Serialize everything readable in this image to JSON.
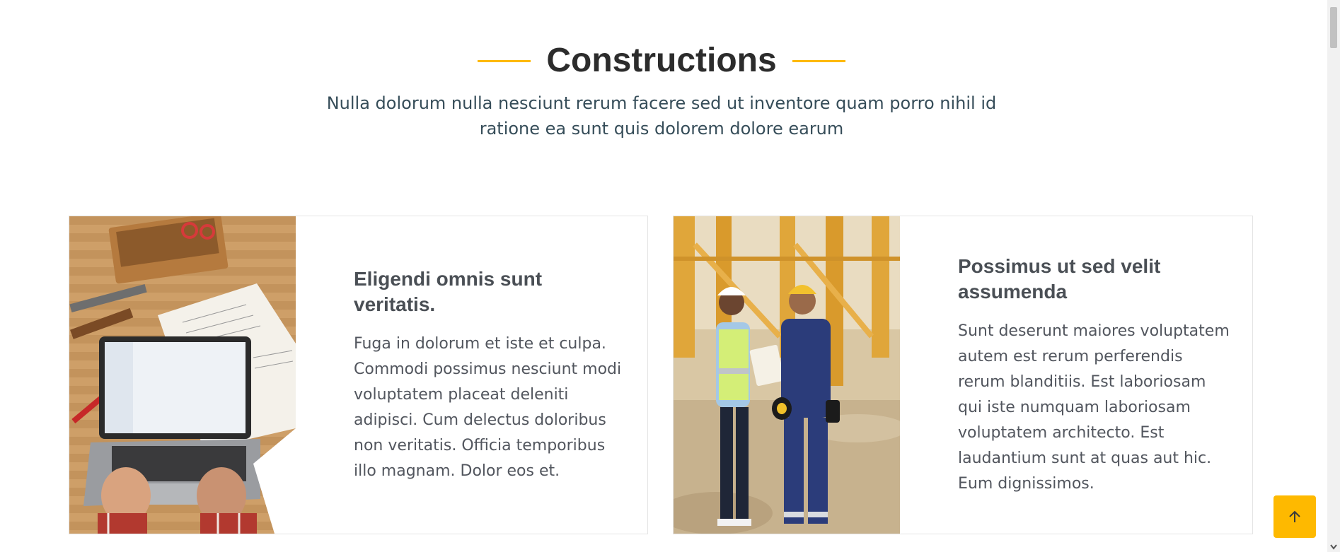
{
  "section": {
    "title": "Constructions",
    "subtitle": "Nulla dolorum nulla nesciunt rerum facere sed ut inventore quam porro nihil id ratione ea sunt quis dolorem dolore earum"
  },
  "cards": [
    {
      "title": "Eligendi omnis sunt veritatis.",
      "text": "Fuga in dolorum et iste et culpa. Commodi possimus nesciunt modi voluptatem placeat deleniti adipisci. Cum delectus doloribus non veritatis. Officia temporibus illo magnam. Dolor eos et.",
      "image": "laptop-and-tools-on-workbench"
    },
    {
      "title": "Possimus ut sed velit assumenda",
      "text": "Sunt deserunt maiores voluptatem autem est rerum perferendis rerum blanditiis. Est laboriosam qui iste numquam laboriosam voluptatem architecto. Est laudantium sunt at quas aut hic. Eum dignissimos.",
      "image": "construction-workers-on-site"
    }
  ],
  "scroll_top": {
    "icon": "arrow-up-icon"
  },
  "colors": {
    "accent": "#feb900",
    "heading": "#2c2c2c",
    "text": "#364d59"
  }
}
